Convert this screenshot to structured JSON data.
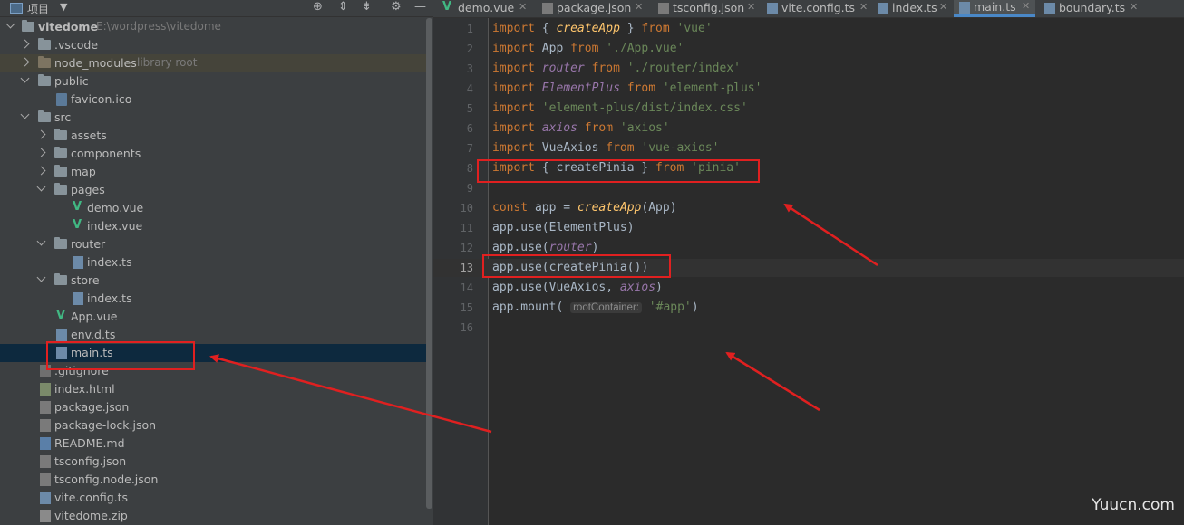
{
  "project_panel": {
    "title": "项目",
    "tree": [
      {
        "label": "vitedome",
        "hint": "E:\\wordpress\\vitedome",
        "kind": "root"
      },
      {
        "label": ".vscode",
        "kind": "folder"
      },
      {
        "label": "node_modules",
        "hint": "library root",
        "kind": "folder-excluded"
      },
      {
        "label": "public",
        "kind": "folder"
      },
      {
        "label": "favicon.ico",
        "kind": "file"
      },
      {
        "label": "src",
        "kind": "folder"
      },
      {
        "label": "assets",
        "kind": "folder"
      },
      {
        "label": "components",
        "kind": "folder"
      },
      {
        "label": "map",
        "kind": "folder"
      },
      {
        "label": "pages",
        "kind": "folder"
      },
      {
        "label": "demo.vue",
        "kind": "vue"
      },
      {
        "label": "index.vue",
        "kind": "vue"
      },
      {
        "label": "router",
        "kind": "folder"
      },
      {
        "label": "index.ts",
        "kind": "ts"
      },
      {
        "label": "store",
        "kind": "folder"
      },
      {
        "label": "index.ts",
        "kind": "ts"
      },
      {
        "label": "App.vue",
        "kind": "vue"
      },
      {
        "label": "env.d.ts",
        "kind": "ts"
      },
      {
        "label": "main.ts",
        "kind": "ts",
        "selected": true
      },
      {
        "label": ".gitignore",
        "kind": "file"
      },
      {
        "label": "index.html",
        "kind": "html"
      },
      {
        "label": "package.json",
        "kind": "json"
      },
      {
        "label": "package-lock.json",
        "kind": "json"
      },
      {
        "label": "README.md",
        "kind": "md"
      },
      {
        "label": "tsconfig.json",
        "kind": "json"
      },
      {
        "label": "tsconfig.node.json",
        "kind": "json"
      },
      {
        "label": "vite.config.ts",
        "kind": "ts"
      },
      {
        "label": "vitedome.zip",
        "kind": "zip"
      }
    ]
  },
  "tabs": [
    {
      "label": "demo.vue",
      "icon": "vue-icon"
    },
    {
      "label": "package.json",
      "icon": "json-icon"
    },
    {
      "label": "tsconfig.json",
      "icon": "json-icon"
    },
    {
      "label": "vite.config.ts",
      "icon": "ts-icon"
    },
    {
      "label": "index.ts",
      "icon": "ts-icon"
    },
    {
      "label": "main.ts",
      "icon": "ts-icon",
      "active": true
    },
    {
      "label": "boundary.ts",
      "icon": "ts-icon"
    }
  ],
  "editor": {
    "line_numbers": [
      "1",
      "2",
      "3",
      "4",
      "5",
      "6",
      "7",
      "8",
      "9",
      "10",
      "11",
      "12",
      "13",
      "14",
      "15",
      "16"
    ],
    "current_line": "13",
    "inlay_hint": "rootContainer:"
  },
  "watermark": "Yuucn.com"
}
